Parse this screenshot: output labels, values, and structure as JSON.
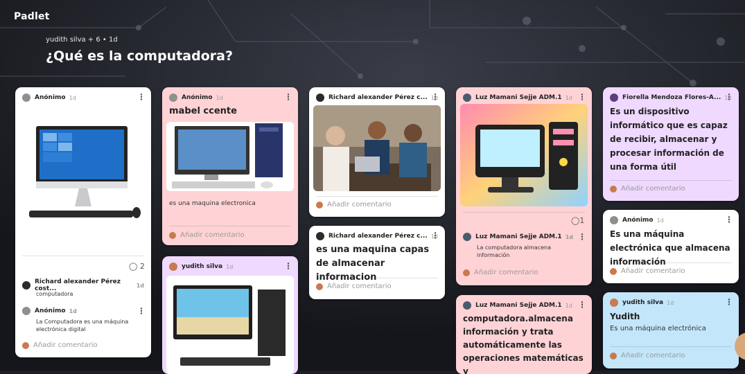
{
  "app": {
    "brand": "Padlet"
  },
  "board": {
    "meta": "yudith silva + 6 • 1d",
    "title": "¿Qué es la computadora?"
  },
  "comment_placeholder": "Añadir comentario",
  "columns": [
    {
      "posts": [
        {
          "author": "Anónimo",
          "time": "1d",
          "comment_count": "2",
          "comments": [
            {
              "author": "Richard alexander Pérez cost...",
              "time": "1d",
              "text": "computadora"
            },
            {
              "author": "Anónimo",
              "time": "1d",
              "text": "La Computadora es una máquina electrónica digital"
            }
          ]
        }
      ]
    },
    {
      "posts": [
        {
          "author": "Anónimo",
          "time": "1d",
          "subject": "mabel ccente",
          "body": "es una maquina electronica"
        },
        {
          "author": "yudith silva",
          "time": "1d"
        }
      ]
    },
    {
      "posts": [
        {
          "author": "Richard alexander Pérez c...",
          "time": "1d"
        },
        {
          "author": "Richard alexander Pérez c...",
          "time": "1d",
          "subject": "es una maquina capas de almacenar informacion"
        }
      ]
    },
    {
      "posts": [
        {
          "author": "Luz Mamani Sejje ADM.1",
          "time": "1d",
          "comment_count": "1",
          "comments": [
            {
              "author": "Luz Mamani Sejje ADM.1",
              "time": "1d",
              "text": "La computadora almacena información"
            }
          ]
        },
        {
          "author": "Luz Mamani Sejje ADM.1",
          "time": "1d",
          "subject": "computadora.almacena información y trata automáticamente las operaciones matemáticas y"
        }
      ]
    },
    {
      "posts": [
        {
          "author": "Fiorella Mendoza Flores-A...",
          "time": "1d",
          "subject": "Es un dispositivo informático que es capaz de recibir, almacenar y procesar información de una forma útil"
        },
        {
          "author": "Anónimo",
          "time": "1d",
          "subject": "Es una máquina electrónica que almacena información"
        },
        {
          "author": "yudith silva",
          "time": "1d",
          "subject": "Yudith",
          "body": "Es una máquina electrónica"
        }
      ]
    }
  ]
}
